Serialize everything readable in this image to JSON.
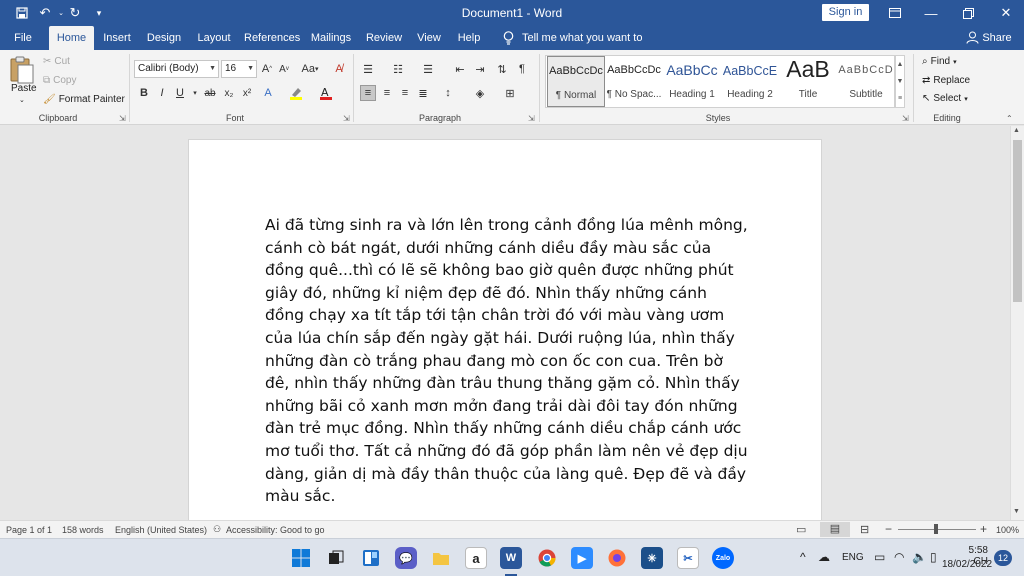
{
  "titlebar": {
    "title": "Document1  -  Word",
    "sign_in": "Sign in"
  },
  "tabs": [
    "File",
    "Home",
    "Insert",
    "Design",
    "Layout",
    "References",
    "Mailings",
    "Review",
    "View",
    "Help"
  ],
  "tell_me": "Tell me what you want to do",
  "share": "Share",
  "clipboard": {
    "paste": "Paste",
    "cut": "Cut",
    "copy": "Copy",
    "format_painter": "Format Painter",
    "label": "Clipboard"
  },
  "font": {
    "family": "Calibri (Body)",
    "size": "16",
    "label": "Font"
  },
  "paragraph": {
    "label": "Paragraph"
  },
  "styles": {
    "label": "Styles",
    "items": [
      {
        "preview": "AaBbCcDc",
        "name": "¶ Normal"
      },
      {
        "preview": "AaBbCcDc",
        "name": "¶ No Spac..."
      },
      {
        "preview": "AaBbCc",
        "name": "Heading 1"
      },
      {
        "preview": "AaBbCcE",
        "name": "Heading 2"
      },
      {
        "preview": "AaB",
        "name": "Title"
      },
      {
        "preview": "AaBbCcD",
        "name": "Subtitle"
      }
    ]
  },
  "editing": {
    "find": "Find",
    "replace": "Replace",
    "select": "Select",
    "label": "Editing"
  },
  "document": {
    "text": "Ai đã từng sinh ra và lớn lên trong cảnh đồng lúa mênh mông, cánh cò bát ngát, dưới những cánh diều đầy màu sắc của đồng quê...thì có lẽ sẽ không bao giờ quên được những phút giây đó, những kỉ niệm đẹp đẽ đó. Nhìn thấy những cánh đồng chạy xa tít tắp tới tận chân trời đó với màu vàng ươm của lúa chín sắp đến ngày gặt hái. Dưới ruộng lúa, nhìn thấy những đàn cò trắng phau đang mò con ốc con cua. Trên bờ đê, nhìn thấy những đàn trâu thung thăng gặm cỏ. Nhìn thấy những bãi cỏ xanh mơn mởn đang trải dài đôi tay đón những đàn trẻ mục đồng. Nhìn thấy những cánh diều chắp cánh ước mơ tuổi thơ. Tất cả những đó đã góp phần làm nên vẻ đẹp dịu dàng, giản dị mà đầy thân thuộc của làng quê. Đẹp đẽ và đầy màu sắc."
  },
  "status": {
    "page": "Page 1 of 1",
    "words": "158 words",
    "language": "English (United States)",
    "accessibility": "Accessibility: Good to go",
    "zoom": "100%"
  },
  "taskbar": {
    "language": "ENG",
    "time": "5:58 CH",
    "date": "18/02/2022",
    "notifications": "12",
    "zalo_label": "Zalo"
  },
  "colors": {
    "word_blue": "#2b579a",
    "ribbon_bg": "#f3f3f3",
    "canvas_bg": "#e6e6e6"
  }
}
